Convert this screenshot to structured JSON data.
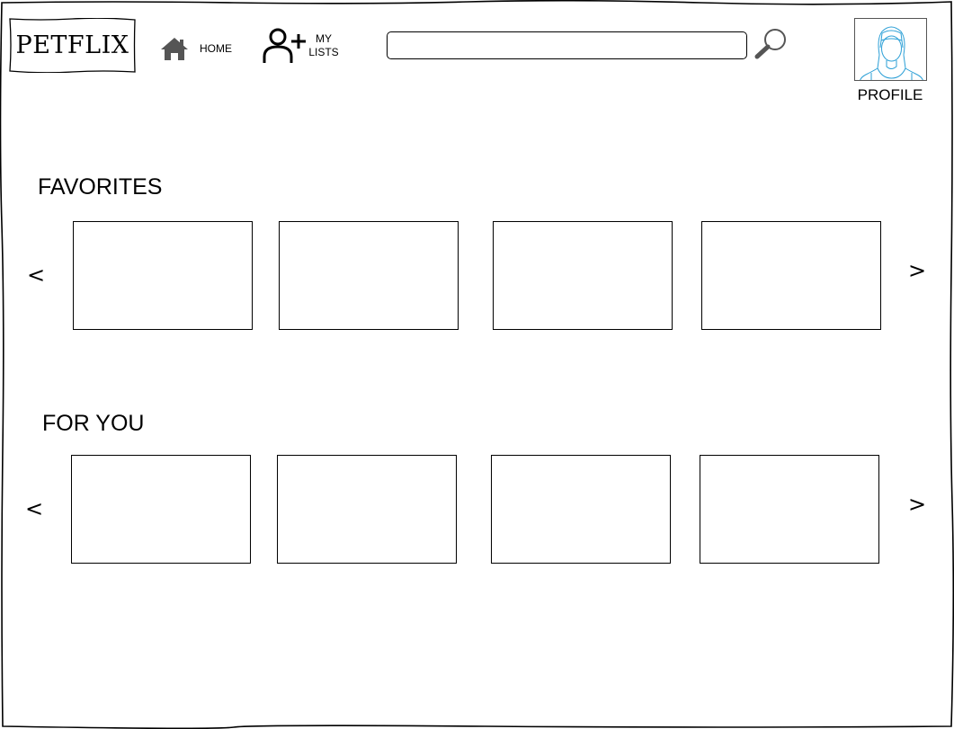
{
  "header": {
    "logo_text": "PETFLIX",
    "home_label": "HOME",
    "my_lists_label_line1": "MY",
    "my_lists_label_line2": "LISTS",
    "search_value": "",
    "search_placeholder": "",
    "profile_label": "PROFILE"
  },
  "sections": [
    {
      "title": "FAVORITES",
      "prev_label": "<",
      "next_label": ">",
      "item_count": 4
    },
    {
      "title": "FOR YOU",
      "prev_label": "<",
      "next_label": ">",
      "item_count": 4
    }
  ],
  "icons": {
    "home": "home-icon",
    "add_user": "add-user-icon",
    "search": "magnifier-icon",
    "avatar": "user-portrait-icon"
  },
  "colors": {
    "ink": "#000000",
    "icon_gray": "#555555",
    "avatar_stroke": "#2b9fd6"
  }
}
